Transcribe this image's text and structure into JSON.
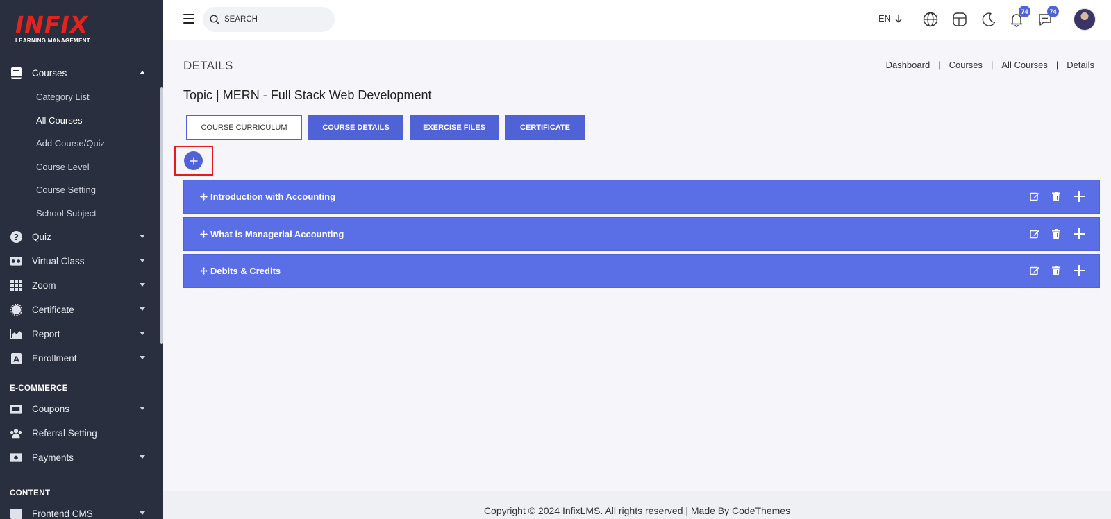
{
  "logo": {
    "word": "INFIX",
    "sub": "LEARNING MANAGEMENT"
  },
  "sidebar": {
    "courses": {
      "label": "Courses",
      "items": [
        "Category List",
        "All Courses",
        "Add Course/Quiz",
        "Course Level",
        "Course Setting",
        "School Subject"
      ]
    },
    "menu": [
      {
        "label": "Quiz",
        "icon": "question-icon"
      },
      {
        "label": "Virtual Class",
        "icon": "vr-headset-icon"
      },
      {
        "label": "Zoom",
        "icon": "grid-icon"
      },
      {
        "label": "Certificate",
        "icon": "certificate-icon"
      },
      {
        "label": "Report",
        "icon": "chart-area-icon"
      },
      {
        "label": "Enrollment",
        "icon": "enrollment-icon"
      }
    ],
    "section_ecommerce": "E-COMMERCE",
    "ecommerce": [
      {
        "label": "Coupons",
        "icon": "ticket-icon"
      },
      {
        "label": "Referral Setting",
        "icon": "users-icon"
      },
      {
        "label": "Payments",
        "icon": "money-icon"
      }
    ],
    "section_content": "CONTENT",
    "content": [
      {
        "label": "Frontend CMS",
        "icon": "cms-icon"
      }
    ]
  },
  "header": {
    "search_placeholder": "SEARCH",
    "lang": "EN",
    "notifications_count": "74",
    "messages_count": "74"
  },
  "page": {
    "title": "DETAILS",
    "breadcrumb": [
      "Dashboard",
      "Courses",
      "All Courses",
      "Details"
    ],
    "topic": "Topic | MERN - Full Stack Web Development",
    "tabs": [
      "COURSE CURRICULUM",
      "COURSE DETAILS",
      "EXERCISE FILES",
      "CERTIFICATE"
    ],
    "topics": [
      "Introduction with Accounting",
      "What is Managerial Accounting",
      "Debits & Credits"
    ]
  },
  "footer": {
    "text": "Copyright © 2024 InfixLMS. All rights reserved | Made By CodeThemes"
  },
  "colors": {
    "accent": "#4f62d6",
    "sidebar_bg": "#2a2f3f",
    "highlight": "#e8191e"
  }
}
